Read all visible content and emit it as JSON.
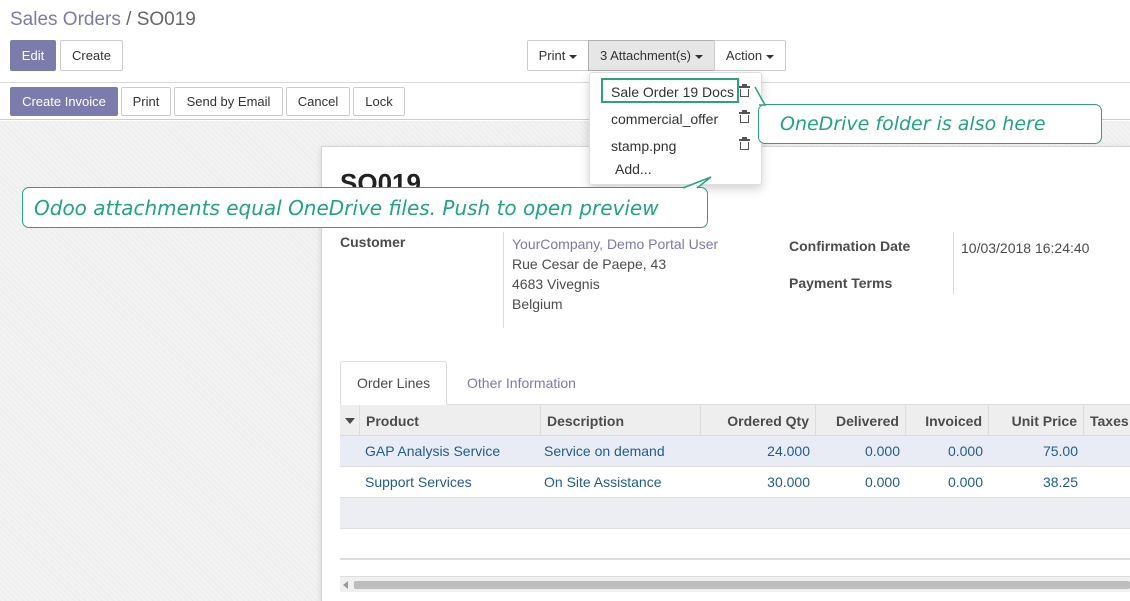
{
  "breadcrumb": {
    "parent": "Sales Orders",
    "separator": "/",
    "current": "SO019"
  },
  "buttons": {
    "edit": "Edit",
    "create": "Create",
    "print": "Print",
    "attachments": "3 Attachment(s)",
    "action": "Action"
  },
  "statusbar": {
    "create_invoice": "Create Invoice",
    "print": "Print",
    "send_email": "Send by Email",
    "cancel": "Cancel",
    "lock": "Lock"
  },
  "attachments_menu": {
    "items": [
      {
        "name": "Sale Order 19 Docs"
      },
      {
        "name": "commercial_offer"
      },
      {
        "name": "stamp.png"
      }
    ],
    "add": "Add..."
  },
  "callouts": {
    "onedrive_folder": "OneDrive folder is also here",
    "attachments_equal": "Odoo attachments equal OneDrive files. Push to open preview"
  },
  "record": {
    "title": "SO019",
    "customer_label": "Customer",
    "customer_name": "YourCompany, Demo Portal User",
    "address_line1": "Rue Cesar de Paepe, 43",
    "address_line2": "4683 Vivegnis",
    "country": "Belgium",
    "confirmation_date_label": "Confirmation Date",
    "confirmation_date": "10/03/2018 16:24:40",
    "payment_terms_label": "Payment Terms"
  },
  "tabs": {
    "order_lines": "Order Lines",
    "other_information": "Other Information"
  },
  "table": {
    "headers": {
      "product": "Product",
      "description": "Description",
      "ordered_qty": "Ordered Qty",
      "delivered": "Delivered",
      "invoiced": "Invoiced",
      "unit_price": "Unit Price",
      "taxes": "Taxes"
    },
    "rows": [
      {
        "product": "GAP Analysis Service",
        "description": "Service on demand",
        "ordered_qty": "24.000",
        "delivered": "0.000",
        "invoiced": "0.000",
        "unit_price": "75.00"
      },
      {
        "product": "Support Services",
        "description": "On Site Assistance",
        "ordered_qty": "30.000",
        "delivered": "0.000",
        "invoiced": "0.000",
        "unit_price": "38.25"
      }
    ]
  },
  "colors": {
    "brand": "#7c7bad",
    "callout": "#2aa37f",
    "link": "#1f5d8c"
  },
  "icons": [
    "trash-icon",
    "caret-down-icon",
    "sort-caret-icon",
    "scroll-left-icon"
  ]
}
